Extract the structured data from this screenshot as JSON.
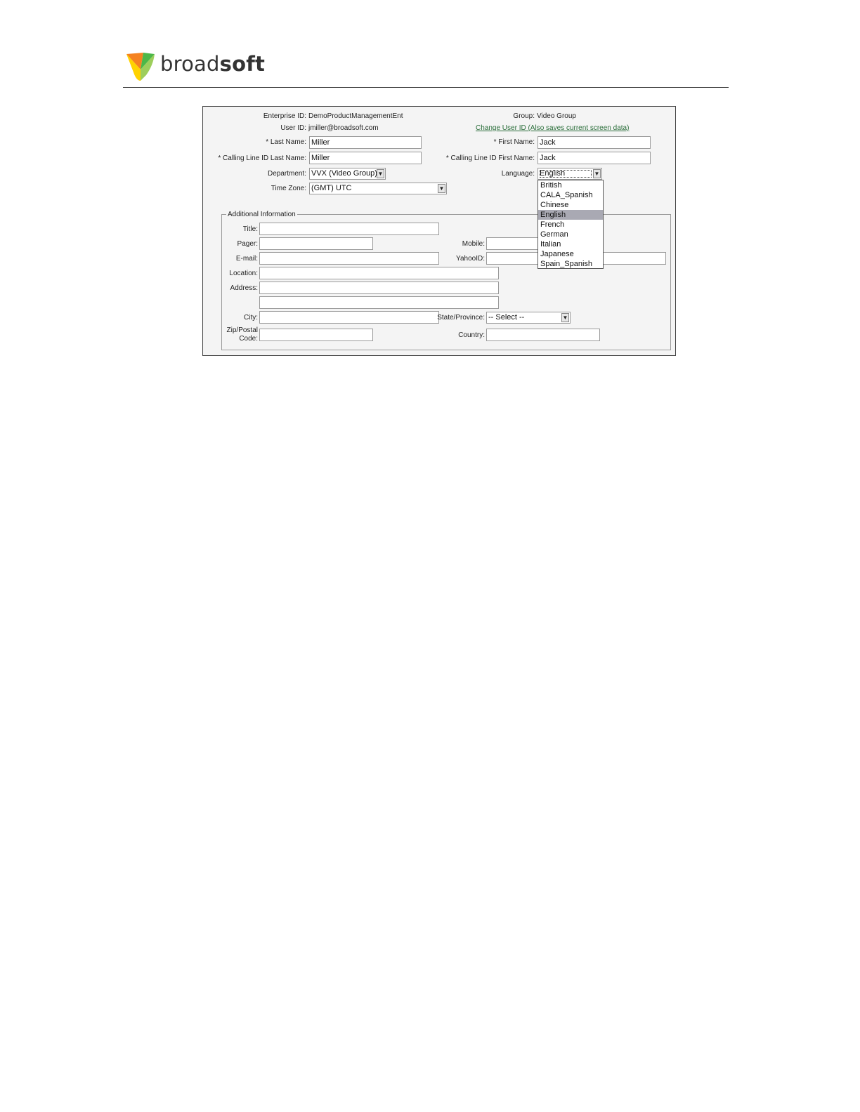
{
  "brand": {
    "name_light": "broad",
    "name_bold": "soft",
    "colors": {
      "orange": "#f58220",
      "green": "#4cb748",
      "yellow": "#ffd200"
    }
  },
  "header_info": {
    "enterprise_label": "Enterprise ID:",
    "enterprise_value": "DemoProductManagementEnt",
    "group_label": "Group:",
    "group_value": "Video Group",
    "userid_label": "User ID:",
    "userid_value": "jmiller@broadsoft.com",
    "change_userid_link": "Change User ID (Also saves current screen data)"
  },
  "form": {
    "last_name_label": "* Last Name:",
    "last_name_value": "Miller",
    "first_name_label": "* First Name:",
    "first_name_value": "Jack",
    "clid_last_label": "* Calling Line ID Last Name:",
    "clid_last_value": "Miller",
    "clid_first_label": "* Calling Line ID First Name:",
    "clid_first_value": "Jack",
    "department_label": "Department:",
    "department_value": "VVX (Video Group)",
    "language_label": "Language:",
    "language_value": "English",
    "timezone_label": "Time Zone:",
    "timezone_value": "(GMT) UTC"
  },
  "language_options": [
    "British",
    "CALA_Spanish",
    "Chinese",
    "English",
    "French",
    "German",
    "Italian",
    "Japanese",
    "Spain_Spanish"
  ],
  "language_selected": "English",
  "additional": {
    "legend": "Additional Information",
    "title_label": "Title:",
    "pager_label": "Pager:",
    "mobile_label": "Mobile:",
    "email_label": "E-mail:",
    "yahooid_label": "YahooID:",
    "location_label": "Location:",
    "address_label": "Address:",
    "city_label": "City:",
    "state_label": "State/Province:",
    "state_value": "-- Select --",
    "zip_label_line1": "Zip/Postal",
    "zip_label_line2": "Code:",
    "country_label": "Country:"
  }
}
